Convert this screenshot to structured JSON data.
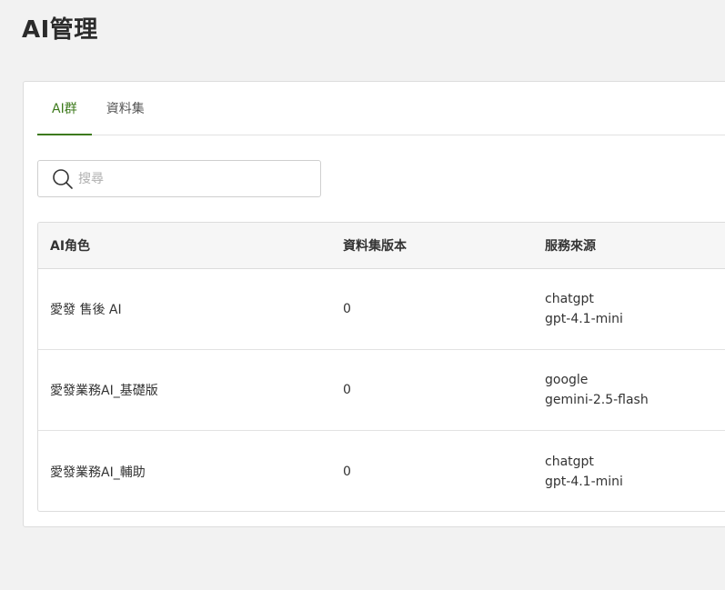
{
  "page": {
    "title": "AI管理"
  },
  "tabs": [
    {
      "label": "AI群",
      "active": true
    },
    {
      "label": "資料集",
      "active": false
    }
  ],
  "search": {
    "placeholder": "搜尋",
    "value": "",
    "icon": "search-icon"
  },
  "table": {
    "headers": {
      "role": "AI角色",
      "version": "資料集版本",
      "source": "服務來源"
    },
    "rows": [
      {
        "role": "愛發 售後 AI",
        "version": "0",
        "provider": "chatgpt",
        "model": "gpt-4.1-mini"
      },
      {
        "role": "愛發業務AI_基礎版",
        "version": "0",
        "provider": "google",
        "model": "gemini-2.5-flash"
      },
      {
        "role": "愛發業務AI_輔助",
        "version": "0",
        "provider": "chatgpt",
        "model": "gpt-4.1-mini"
      }
    ]
  },
  "colors": {
    "accent": "#3d7a1c",
    "background": "#f2f2f2",
    "card": "#ffffff",
    "header_bg": "#f6f6f6"
  }
}
